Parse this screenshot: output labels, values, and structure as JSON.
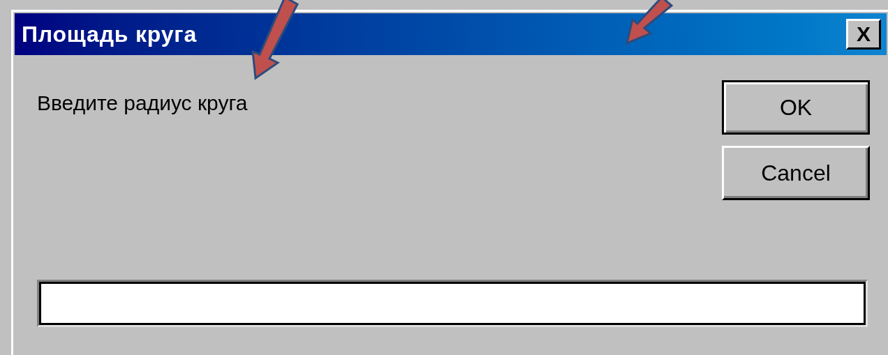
{
  "window": {
    "title": "Площадь круга",
    "close": "X"
  },
  "prompt": "Введите радиус круга",
  "buttons": [
    {
      "label": "OK",
      "default": true
    },
    {
      "label": "Cancel",
      "default": false
    }
  ]
}
